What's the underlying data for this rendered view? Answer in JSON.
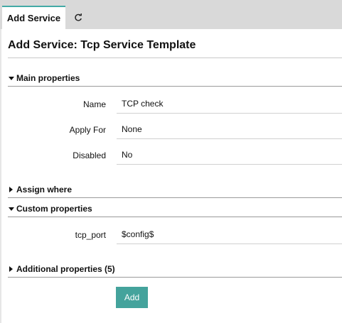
{
  "tabs": {
    "active_label": "Add Service",
    "refresh_icon": "refresh-icon"
  },
  "page": {
    "title": "Add Service: Tcp Service Template"
  },
  "sections": {
    "main": {
      "label": "Main properties",
      "expanded": true
    },
    "assign": {
      "label": "Assign where",
      "expanded": false
    },
    "custom": {
      "label": "Custom properties",
      "expanded": true
    },
    "additional": {
      "label": "Additional properties (5)",
      "expanded": false
    }
  },
  "fields": {
    "name": {
      "label": "Name",
      "value": "TCP check"
    },
    "apply_for": {
      "label": "Apply For",
      "value": "None"
    },
    "disabled": {
      "label": "Disabled",
      "value": "No"
    },
    "tcp_port": {
      "label": "tcp_port",
      "value": "$config$"
    }
  },
  "actions": {
    "add_label": "Add"
  },
  "colors": {
    "accent": "#44a39c",
    "tabbar": "#d9d9d9"
  }
}
